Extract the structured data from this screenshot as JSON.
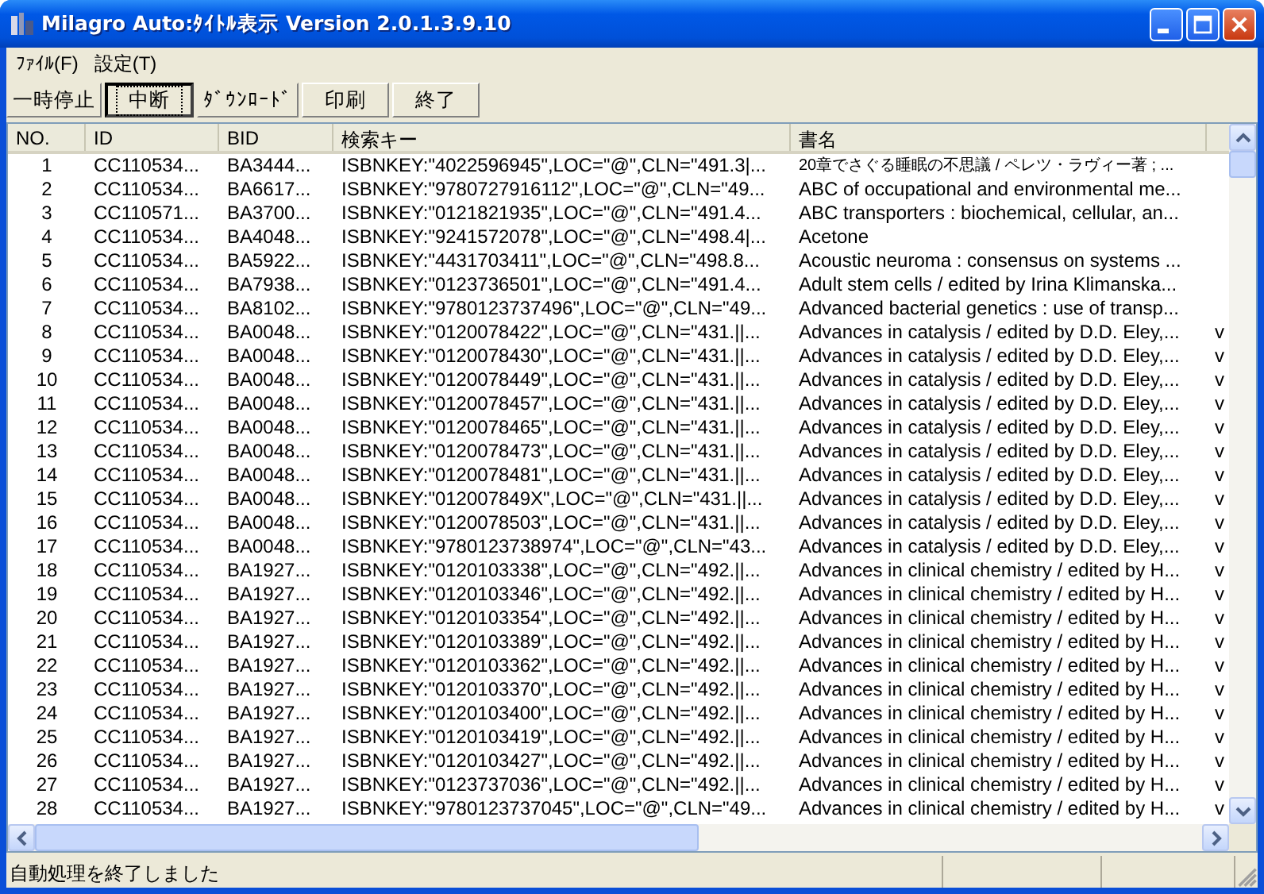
{
  "window": {
    "title": "Milagro Auto:ﾀｲﾄﾙ表示 Version 2.0.1.3.9.10"
  },
  "menu": [
    "ﾌｧｲﾙ(F)",
    "設定(T)"
  ],
  "toolbar": [
    {
      "label": "一時停止",
      "kind": "flat",
      "focused": false
    },
    {
      "label": "中断",
      "kind": "button",
      "focused": true
    },
    {
      "label": "ﾀﾞｳﾝﾛｰﾄﾞ",
      "kind": "flat",
      "focused": false
    },
    {
      "label": "印刷",
      "kind": "button",
      "focused": false
    },
    {
      "label": "終了",
      "kind": "button",
      "focused": false
    }
  ],
  "table": {
    "columns": [
      "NO.",
      "ID",
      "BID",
      "検索キー",
      "書名"
    ],
    "rows": [
      {
        "no": "1",
        "id": "CC110534...",
        "bid": "BA3444...",
        "key": "ISBNKEY:\"4022596945\",LOC=\"@\",CLN=\"491.3|...",
        "title": "20章でさぐる睡眠の不思議 / ペレツ・ラヴィー著 ; ..."
      },
      {
        "no": "2",
        "id": "CC110534...",
        "bid": "BA6617...",
        "key": "ISBNKEY:\"9780727916112\",LOC=\"@\",CLN=\"49...",
        "title": "ABC of occupational and environmental me..."
      },
      {
        "no": "3",
        "id": "CC110571...",
        "bid": "BA3700...",
        "key": "ISBNKEY:\"0121821935\",LOC=\"@\",CLN=\"491.4...",
        "title": "ABC transporters : biochemical, cellular, an..."
      },
      {
        "no": "4",
        "id": "CC110534...",
        "bid": "BA4048...",
        "key": "ISBNKEY:\"9241572078\",LOC=\"@\",CLN=\"498.4|...",
        "title": "Acetone"
      },
      {
        "no": "5",
        "id": "CC110534...",
        "bid": "BA5922...",
        "key": "ISBNKEY:\"4431703411\",LOC=\"@\",CLN=\"498.8...",
        "title": "Acoustic neuroma : consensus on systems ..."
      },
      {
        "no": "6",
        "id": "CC110534...",
        "bid": "BA7938...",
        "key": "ISBNKEY:\"0123736501\",LOC=\"@\",CLN=\"491.4...",
        "title": "Adult stem cells / edited by Irina Klimanska..."
      },
      {
        "no": "7",
        "id": "CC110534...",
        "bid": "BA8102...",
        "key": "ISBNKEY:\"9780123737496\",LOC=\"@\",CLN=\"49...",
        "title": "Advanced bacterial genetics : use of transp..."
      },
      {
        "no": "8",
        "id": "CC110534...",
        "bid": "BA0048...",
        "key": "ISBNKEY:\"0120078422\",LOC=\"@\",CLN=\"431.||...",
        "title": "Advances in catalysis / edited by D.D. Eley,...",
        "column_6": "v"
      },
      {
        "no": "9",
        "id": "CC110534...",
        "bid": "BA0048...",
        "key": "ISBNKEY:\"0120078430\",LOC=\"@\",CLN=\"431.||...",
        "title": "Advances in catalysis / edited by D.D. Eley,...",
        "column_6": "v"
      },
      {
        "no": "10",
        "id": "CC110534...",
        "bid": "BA0048...",
        "key": "ISBNKEY:\"0120078449\",LOC=\"@\",CLN=\"431.||...",
        "title": "Advances in catalysis / edited by D.D. Eley,...",
        "column_6": "v"
      },
      {
        "no": "11",
        "id": "CC110534...",
        "bid": "BA0048...",
        "key": "ISBNKEY:\"0120078457\",LOC=\"@\",CLN=\"431.||...",
        "title": "Advances in catalysis / edited by D.D. Eley,...",
        "column_6": "v"
      },
      {
        "no": "12",
        "id": "CC110534...",
        "bid": "BA0048...",
        "key": "ISBNKEY:\"0120078465\",LOC=\"@\",CLN=\"431.||...",
        "title": "Advances in catalysis / edited by D.D. Eley,...",
        "column_6": "v"
      },
      {
        "no": "13",
        "id": "CC110534...",
        "bid": "BA0048...",
        "key": "ISBNKEY:\"0120078473\",LOC=\"@\",CLN=\"431.||...",
        "title": "Advances in catalysis / edited by D.D. Eley,...",
        "column_6": "v"
      },
      {
        "no": "14",
        "id": "CC110534...",
        "bid": "BA0048...",
        "key": "ISBNKEY:\"0120078481\",LOC=\"@\",CLN=\"431.||...",
        "title": "Advances in catalysis / edited by D.D. Eley,...",
        "column_6": "v"
      },
      {
        "no": "15",
        "id": "CC110534...",
        "bid": "BA0048...",
        "key": "ISBNKEY:\"012007849X\",LOC=\"@\",CLN=\"431.||...",
        "title": "Advances in catalysis / edited by D.D. Eley,...",
        "column_6": "v"
      },
      {
        "no": "16",
        "id": "CC110534...",
        "bid": "BA0048...",
        "key": "ISBNKEY:\"0120078503\",LOC=\"@\",CLN=\"431.||...",
        "title": "Advances in catalysis / edited by D.D. Eley,...",
        "column_6": "v"
      },
      {
        "no": "17",
        "id": "CC110534...",
        "bid": "BA0048...",
        "key": "ISBNKEY:\"9780123738974\",LOC=\"@\",CLN=\"43...",
        "title": "Advances in catalysis / edited by D.D. Eley,...",
        "column_6": "v"
      },
      {
        "no": "18",
        "id": "CC110534...",
        "bid": "BA1927...",
        "key": "ISBNKEY:\"0120103338\",LOC=\"@\",CLN=\"492.||...",
        "title": "Advances in clinical chemistry / edited by H...",
        "column_6": "v"
      },
      {
        "no": "19",
        "id": "CC110534...",
        "bid": "BA1927...",
        "key": "ISBNKEY:\"0120103346\",LOC=\"@\",CLN=\"492.||...",
        "title": "Advances in clinical chemistry / edited by H...",
        "column_6": "v"
      },
      {
        "no": "20",
        "id": "CC110534...",
        "bid": "BA1927...",
        "key": "ISBNKEY:\"0120103354\",LOC=\"@\",CLN=\"492.||...",
        "title": "Advances in clinical chemistry / edited by H...",
        "column_6": "v"
      },
      {
        "no": "21",
        "id": "CC110534...",
        "bid": "BA1927...",
        "key": "ISBNKEY:\"0120103389\",LOC=\"@\",CLN=\"492.||...",
        "title": "Advances in clinical chemistry / edited by H...",
        "column_6": "v"
      },
      {
        "no": "22",
        "id": "CC110534...",
        "bid": "BA1927...",
        "key": "ISBNKEY:\"0120103362\",LOC=\"@\",CLN=\"492.||...",
        "title": "Advances in clinical chemistry / edited by H...",
        "column_6": "v"
      },
      {
        "no": "23",
        "id": "CC110534...",
        "bid": "BA1927...",
        "key": "ISBNKEY:\"0120103370\",LOC=\"@\",CLN=\"492.||...",
        "title": "Advances in clinical chemistry / edited by H...",
        "column_6": "v"
      },
      {
        "no": "24",
        "id": "CC110534...",
        "bid": "BA1927...",
        "key": "ISBNKEY:\"0120103400\",LOC=\"@\",CLN=\"492.||...",
        "title": "Advances in clinical chemistry / edited by H...",
        "column_6": "v"
      },
      {
        "no": "25",
        "id": "CC110534...",
        "bid": "BA1927...",
        "key": "ISBNKEY:\"0120103419\",LOC=\"@\",CLN=\"492.||...",
        "title": "Advances in clinical chemistry / edited by H...",
        "column_6": "v"
      },
      {
        "no": "26",
        "id": "CC110534...",
        "bid": "BA1927...",
        "key": "ISBNKEY:\"0120103427\",LOC=\"@\",CLN=\"492.||...",
        "title": "Advances in clinical chemistry / edited by H...",
        "column_6": "v"
      },
      {
        "no": "27",
        "id": "CC110534...",
        "bid": "BA1927...",
        "key": "ISBNKEY:\"0123737036\",LOC=\"@\",CLN=\"492.||...",
        "title": "Advances in clinical chemistry / edited by H...",
        "column_6": "v"
      },
      {
        "no": "28",
        "id": "CC110534...",
        "bid": "BA1927...",
        "key": "ISBNKEY:\"9780123737045\",LOC=\"@\",CLN=\"49...",
        "title": "Advances in clinical chemistry / edited by H...",
        "column_6": "v"
      }
    ]
  },
  "status_bar": "自動処理を終了しました"
}
